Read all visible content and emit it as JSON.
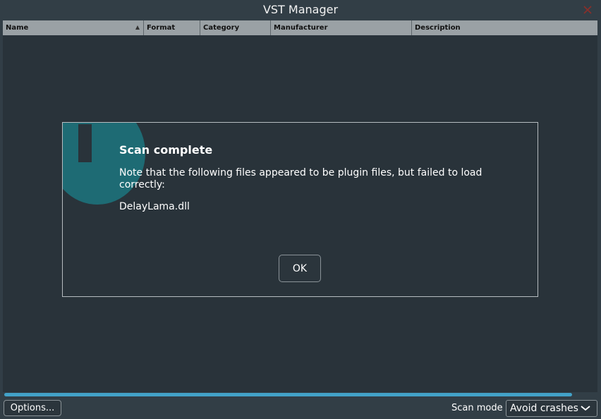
{
  "window": {
    "title": "VST Manager",
    "close_icon": "close-x-icon",
    "close_color": "#c0392b"
  },
  "table": {
    "columns": [
      {
        "label": "Name",
        "sorted": "ascending"
      },
      {
        "label": "Format"
      },
      {
        "label": "Category"
      },
      {
        "label": "Manufacturer"
      },
      {
        "label": "Description"
      }
    ],
    "rows": []
  },
  "progress": {
    "fraction": 0.96,
    "color": "#42a2c8"
  },
  "footer": {
    "options_label": "Options...",
    "scan_mode_label": "Scan mode",
    "scan_mode_value": "Avoid crashes"
  },
  "dialog": {
    "icon": "info-icon",
    "icon_color": "#1e6b74",
    "title": "Scan complete",
    "message": "Note that the following files appeared to be plugin files, but failed to load correctly:",
    "files": "DelayLama.dll",
    "ok_label": "OK"
  }
}
